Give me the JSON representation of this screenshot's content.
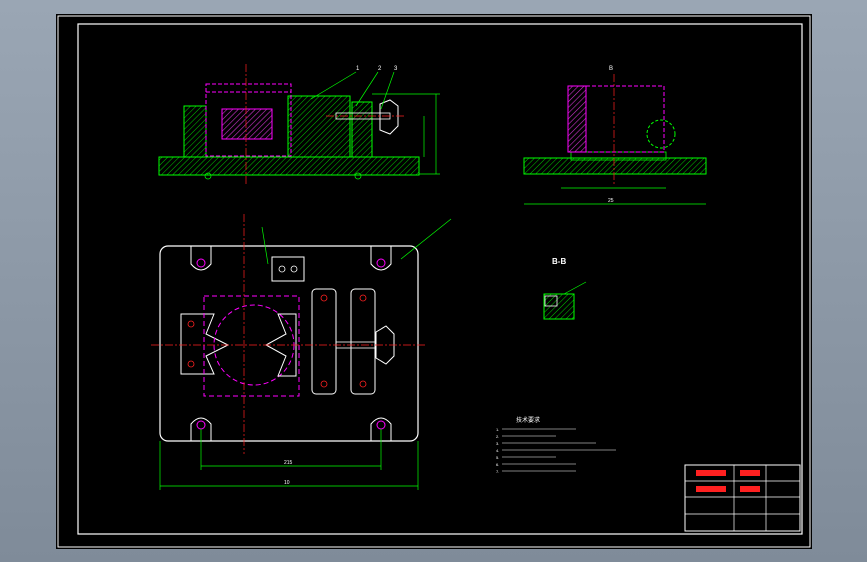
{
  "drawing": {
    "section_label": "B-B",
    "notes_title": "技术要求",
    "notes": [
      "1.",
      "2.",
      "3.",
      "4.",
      "5.",
      "6.",
      "7."
    ],
    "view_label_top_right": "B",
    "dims": {
      "side_view_length": "",
      "front_view_length": "25",
      "plan_inner": "215",
      "plan_overall": "10"
    },
    "balloons": [
      "1",
      "2",
      "3"
    ],
    "title_block": {
      "part_name": "",
      "drawing_number": "",
      "scale": "",
      "sheet": ""
    }
  },
  "colors": {
    "background": "#000000",
    "outline": "#ffffff",
    "fixture": "#00ff00",
    "hidden": "#ff00ff",
    "center": "#ff2020",
    "dimension": "#00ff00",
    "workpiece_hatch": "#cc33cc",
    "annotation": "#ffffff",
    "title_red": "#ff2020"
  }
}
